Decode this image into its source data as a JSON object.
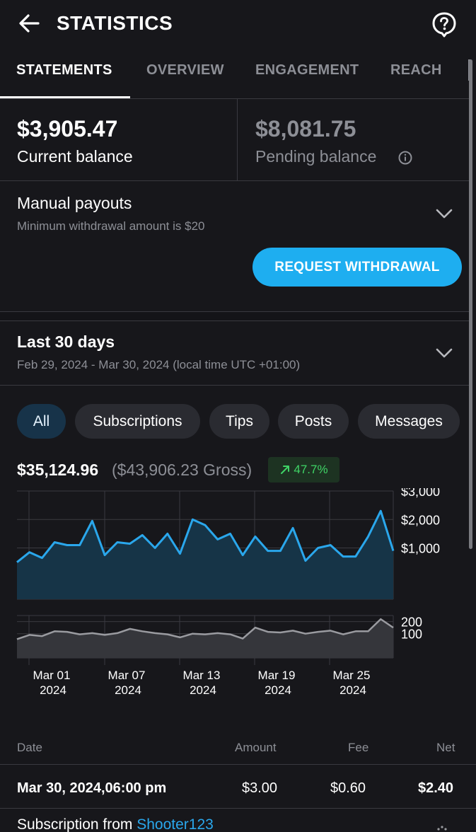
{
  "header": {
    "title": "STATISTICS"
  },
  "tabs": [
    {
      "label": "STATEMENTS",
      "active": true
    },
    {
      "label": "OVERVIEW",
      "active": false
    },
    {
      "label": "ENGAGEMENT",
      "active": false
    },
    {
      "label": "REACH",
      "active": false
    }
  ],
  "balances": {
    "current_value": "$3,905.47",
    "current_label": "Current balance",
    "pending_value": "$8,081.75",
    "pending_label": "Pending balance"
  },
  "payouts": {
    "title": "Manual payouts",
    "subtitle": "Minimum withdrawal amount is $20",
    "button_label": "REQUEST WITHDRAWAL"
  },
  "period": {
    "title": "Last 30 days",
    "subtitle": "Feb 29, 2024 - Mar 30, 2024 (local time UTC +01:00)"
  },
  "filters": [
    {
      "label": "All",
      "active": true
    },
    {
      "label": "Subscriptions",
      "active": false
    },
    {
      "label": "Tips",
      "active": false
    },
    {
      "label": "Posts",
      "active": false
    },
    {
      "label": "Messages",
      "active": false
    }
  ],
  "totals": {
    "net": "$35,124.96",
    "gross": "($43,906.23 Gross)",
    "growth": "47.7%"
  },
  "colors": {
    "accent": "#1eaef0",
    "chart_line": "#2aa7ec",
    "count_line": "#9a9ba0",
    "growth_green": "#3fd466"
  },
  "chart_data": [
    {
      "type": "area",
      "x": [
        "Feb 27",
        "Feb 28",
        "Feb 29",
        "Mar 01",
        "Mar 02",
        "Mar 03",
        "Mar 04",
        "Mar 05",
        "Mar 06",
        "Mar 07",
        "Mar 08",
        "Mar 09",
        "Mar 10",
        "Mar 11",
        "Mar 12",
        "Mar 13",
        "Mar 14",
        "Mar 15",
        "Mar 16",
        "Mar 17",
        "Mar 18",
        "Mar 19",
        "Mar 20",
        "Mar 21",
        "Mar 22",
        "Mar 23",
        "Mar 24",
        "Mar 25",
        "Mar 26",
        "Mar 27",
        "Mar 28"
      ],
      "values": [
        500,
        850,
        650,
        1200,
        1100,
        1100,
        1950,
        750,
        1200,
        1150,
        1450,
        1000,
        1500,
        800,
        2000,
        1800,
        1300,
        1500,
        750,
        1400,
        900,
        900,
        1700,
        550,
        1000,
        1100,
        700,
        700,
        1400,
        2300,
        900
      ],
      "ylim": [
        -800,
        3000
      ],
      "yticks": [
        3000,
        2000,
        1000
      ],
      "ytick_labels": [
        "$3,000",
        "$2,000",
        "$1,000"
      ]
    },
    {
      "type": "area",
      "x": [
        "Feb 27",
        "Feb 28",
        "Feb 29",
        "Mar 01",
        "Mar 02",
        "Mar 03",
        "Mar 04",
        "Mar 05",
        "Mar 06",
        "Mar 07",
        "Mar 08",
        "Mar 09",
        "Mar 10",
        "Mar 11",
        "Mar 12",
        "Mar 13",
        "Mar 14",
        "Mar 15",
        "Mar 16",
        "Mar 17",
        "Mar 18",
        "Mar 19",
        "Mar 20",
        "Mar 21",
        "Mar 22",
        "Mar 23",
        "Mar 24",
        "Mar 25",
        "Mar 26",
        "Mar 27",
        "Mar 28"
      ],
      "values": [
        55,
        90,
        80,
        120,
        115,
        95,
        105,
        90,
        105,
        140,
        120,
        105,
        95,
        70,
        100,
        95,
        105,
        95,
        60,
        150,
        115,
        110,
        125,
        100,
        115,
        125,
        95,
        120,
        120,
        220,
        150
      ],
      "ylim": [
        -100,
        250
      ],
      "yticks": [
        200,
        100
      ],
      "ytick_labels": [
        "200",
        "100"
      ]
    }
  ],
  "x_axis": {
    "labels": [
      {
        "date": "Mar 01",
        "year": "2024"
      },
      {
        "date": "Mar 07",
        "year": "2024"
      },
      {
        "date": "Mar 13",
        "year": "2024"
      },
      {
        "date": "Mar 19",
        "year": "2024"
      },
      {
        "date": "Mar 25",
        "year": "2024"
      }
    ]
  },
  "table": {
    "headers": {
      "date": "Date",
      "amount": "Amount",
      "fee": "Fee",
      "net": "Net"
    },
    "rows": [
      {
        "date": "Mar 30, 2024,06:00 pm",
        "amount": "$3.00",
        "fee": "$0.60",
        "net": "$2.40",
        "description_prefix": "Subscription from",
        "user": "Shooter123"
      }
    ]
  }
}
